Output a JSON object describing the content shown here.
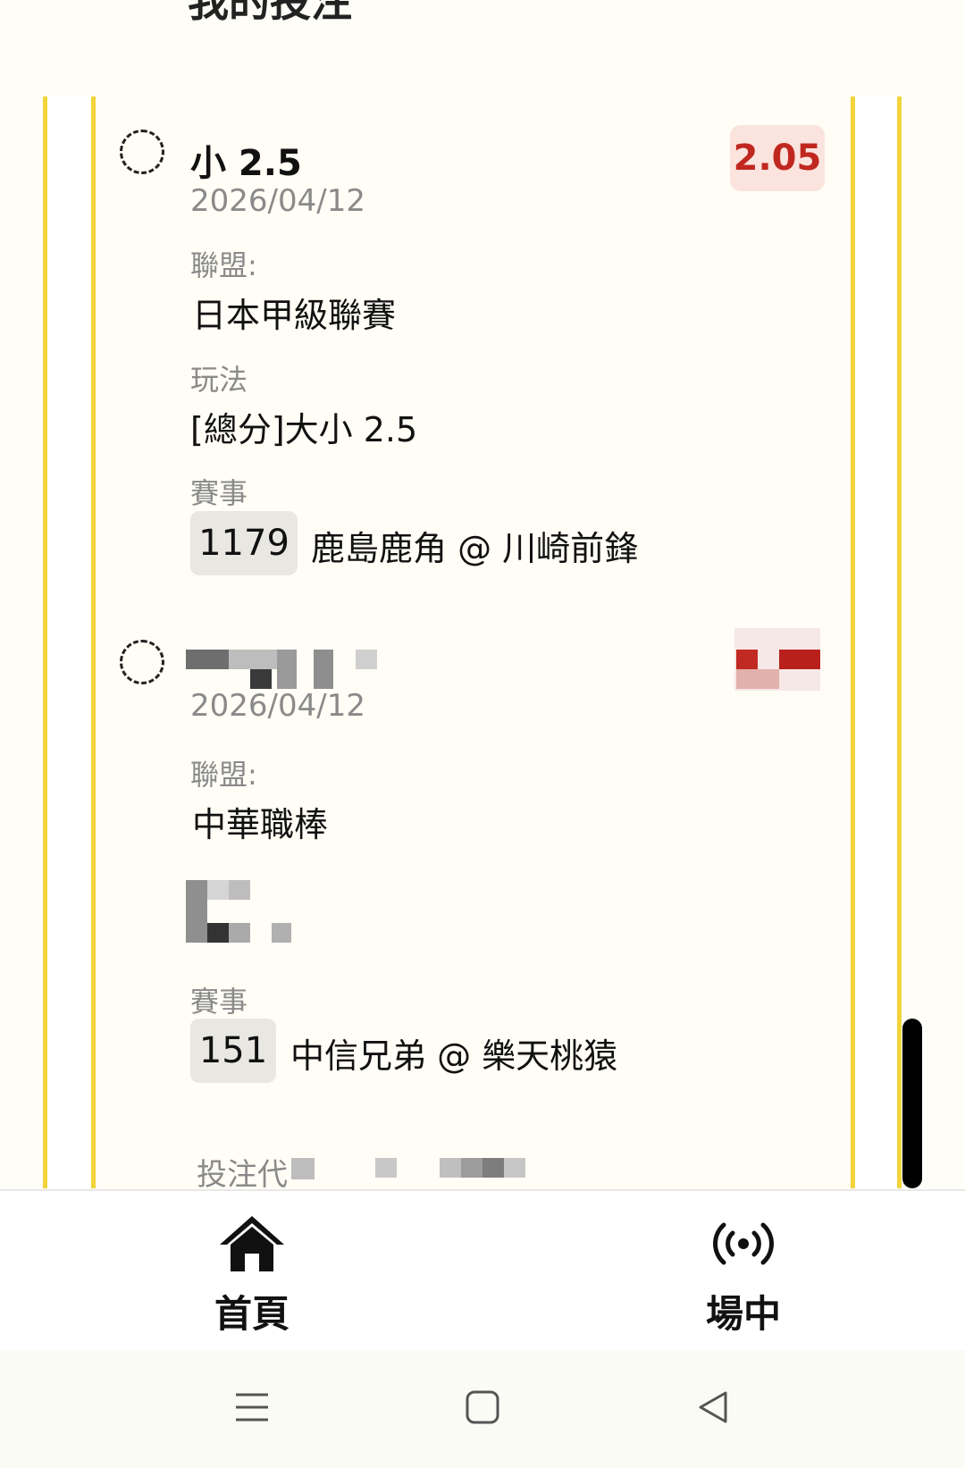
{
  "header": {
    "title_fragment": "我的投注"
  },
  "bets": [
    {
      "selection": "小 2.5",
      "date": "2026/04/12",
      "odds": "2.05",
      "league_label": "聯盟:",
      "league": "日本甲級聯賽",
      "market_label": "玩法",
      "market": "[總分]大小 2.5",
      "event_label": "賽事",
      "match_id": "1179",
      "match": "鹿島鹿角 @ 川崎前鋒"
    },
    {
      "date": "2026/04/12",
      "league_label": "聯盟:",
      "league": "中華職棒",
      "event_label": "賽事",
      "match_id": "151",
      "match": "中信兄弟 @ 樂天桃猿"
    }
  ],
  "footer": {
    "bet_code_label": "投注代"
  },
  "nav": {
    "home": "首頁",
    "live": "場中"
  },
  "colors": {
    "accent_yellow": "#f3d43a",
    "odds_red": "#c0281f",
    "odds_bg": "#fbe3de"
  }
}
